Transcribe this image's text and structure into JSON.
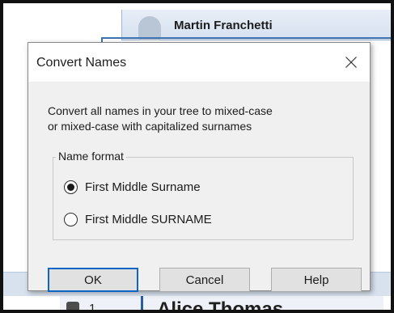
{
  "background": {
    "person_name": "Martin Franchetti",
    "bottom_number": "1",
    "bottom_name": "Alice Thomas"
  },
  "dialog": {
    "title": "Convert Names",
    "close_icon": "close-icon",
    "description_line1": "Convert all names in your tree to mixed-case",
    "description_line2": "or mixed-case with capitalized surnames",
    "group_label": "Name format",
    "options": [
      {
        "label": "First Middle Surname",
        "selected": true
      },
      {
        "label": "First Middle SURNAME",
        "selected": false
      }
    ],
    "buttons": {
      "ok": "OK",
      "cancel": "Cancel",
      "help": "Help"
    }
  },
  "colors": {
    "accent": "#0f64c8",
    "tree_line": "#3f73b0"
  }
}
